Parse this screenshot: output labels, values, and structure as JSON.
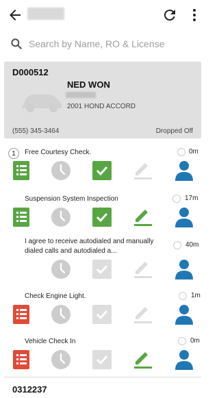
{
  "header": {
    "back_icon": "arrow-back-icon",
    "refresh_icon": "refresh-icon",
    "more_icon": "more-vert-icon"
  },
  "search": {
    "placeholder": "Search by Name, RO & License",
    "icon": "search-icon"
  },
  "vehicle": {
    "ro": "D000512",
    "customer": "NED WON",
    "description": "2001 HOND ACCORD",
    "phone": "(555) 345-3464",
    "status": "Dropped Off"
  },
  "colors": {
    "green": "#58a543",
    "red": "#e04b38",
    "blue": "#1f78b4",
    "gray": "#cccccc"
  },
  "tasks": [
    {
      "badge": "1",
      "title": "Free Courtesy Check.",
      "time": "0m",
      "list_color": "green",
      "check_done": true,
      "edit_active": false
    },
    {
      "badge": "",
      "title": "Suspension System Inspection",
      "time": "17m",
      "list_color": "green",
      "check_done": true,
      "edit_active": true
    },
    {
      "badge": "",
      "title": "I agree to receive autodialed and manually dialed calls and autodialed a...",
      "time": "40m",
      "list_color": "none",
      "check_done": false,
      "edit_active": false
    },
    {
      "badge": "",
      "title": "Check Engine Light.",
      "time": "1m",
      "list_color": "red",
      "check_done": false,
      "edit_active": false
    },
    {
      "badge": "",
      "title": "Vehicle Check In",
      "time": "0m",
      "list_color": "red",
      "check_done": false,
      "edit_active": true
    }
  ],
  "next_vehicle": {
    "ro": "0312237"
  }
}
